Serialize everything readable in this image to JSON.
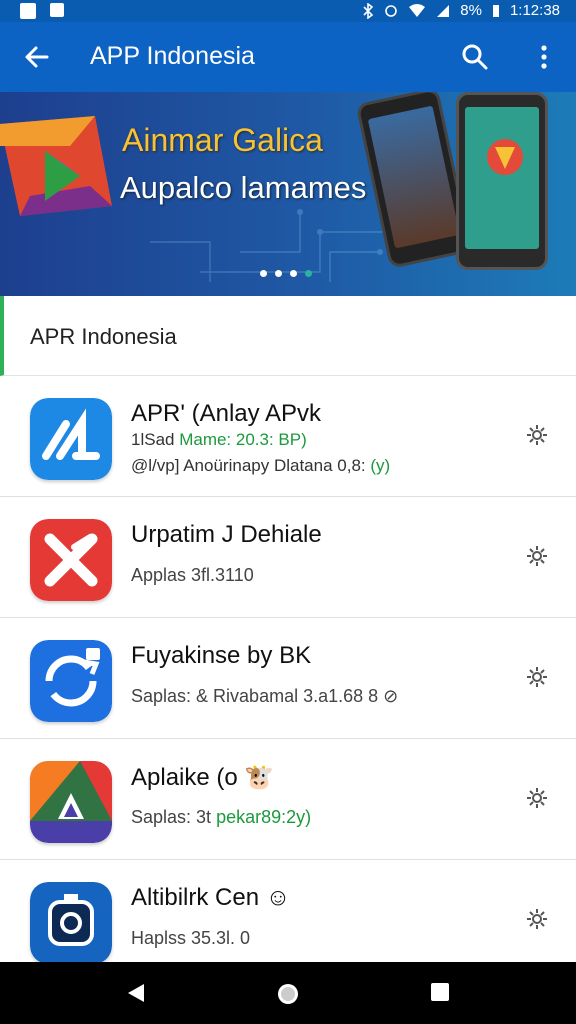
{
  "status_bar": {
    "battery": "8%",
    "time": "1:12:38"
  },
  "appbar": {
    "title": "APP Indonesia",
    "back_icon": "arrow-left-icon",
    "search_icon": "search-icon",
    "more_icon": "more-vert-icon"
  },
  "banner": {
    "headline": "Ainmar Galica",
    "subheadline": "Aupalco lamames",
    "page_dots": 4,
    "active_dot": 4
  },
  "section": {
    "label": "APR Indonesia",
    "accent": "#2fb256"
  },
  "apps": [
    {
      "name": "APR' (Anlay APvk",
      "line1_prefix": "1lSad ",
      "line1_green": "Mame: 20.3: BP)",
      "line2_prefix": "@l/vp] Anoürinapy Dlatana 0,8: ",
      "line2_green": "(y)"
    },
    {
      "name": "Urpatim J Dehiale",
      "line": "Applas 3fl.3110"
    },
    {
      "name": "Fuyakinse by BK",
      "line": "Saplas: & Rivabamal  3.a1.68 8 ⊘"
    },
    {
      "name": "Aplaike (o 🐮",
      "line_prefix": "Saplas: 3t ",
      "line_green": "pekar89:2y)"
    },
    {
      "name": "Altibilrk Cen ☺",
      "line": "Haplss 35.3l. 0"
    }
  ],
  "colors": {
    "appbar": "#0d63c4",
    "status": "#0a5cb0",
    "accent_green": "#1b9a3c"
  }
}
